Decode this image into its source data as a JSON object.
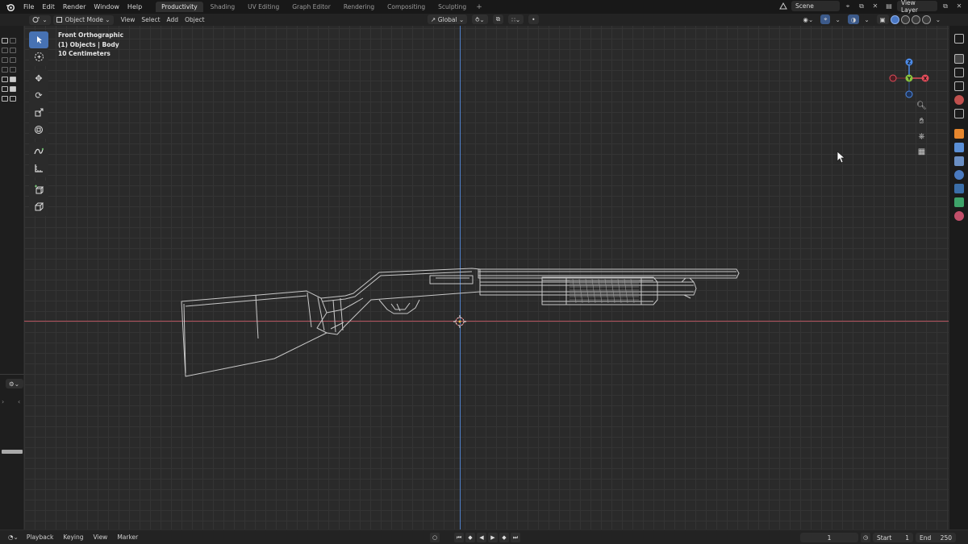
{
  "menu": [
    "File",
    "Edit",
    "Render",
    "Window",
    "Help"
  ],
  "workspaces": [
    {
      "label": "Productivity",
      "active": true
    },
    {
      "label": "Shading",
      "active": false
    },
    {
      "label": "UV Editing",
      "active": false
    },
    {
      "label": "Graph Editor",
      "active": false
    },
    {
      "label": "Rendering",
      "active": false
    },
    {
      "label": "Compositing",
      "active": false
    },
    {
      "label": "Sculpting",
      "active": false
    }
  ],
  "add_workspace": "+",
  "scene": {
    "name": "Scene"
  },
  "view_layer": {
    "name": "View Layer"
  },
  "viewport_header": {
    "mode": "Object Mode",
    "menus": [
      "View",
      "Select",
      "Add",
      "Object"
    ],
    "orientation": "Global"
  },
  "viewport_info": {
    "view": "Front Orthographic",
    "selection": "(1) Objects | Body",
    "scale": "10 Centimeters"
  },
  "gizmo": {
    "x": "X",
    "y": "Y",
    "z": "Z"
  },
  "timeline": {
    "menus": [
      "Playback",
      "Keying",
      "View",
      "Marker"
    ],
    "current_frame": "1",
    "start_label": "Start",
    "start": "1",
    "end_label": "End",
    "end": "250"
  },
  "colors": {
    "accent": "#4772b3",
    "x_axis": "#b5535e",
    "z_axis": "#4f7fc8",
    "gizmo_x": "#e34c5a",
    "gizmo_y": "#8bc43f",
    "gizmo_z": "#4b8ae8"
  }
}
